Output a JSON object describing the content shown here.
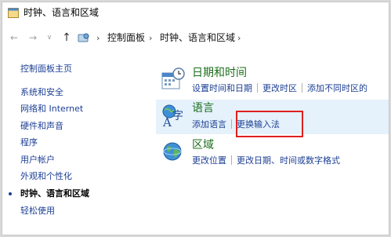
{
  "window": {
    "title": "时钟、语言和区域"
  },
  "address_bar": {
    "crumbs": [
      "控制面板",
      "时钟、语言和区域"
    ]
  },
  "sidebar": {
    "home": "控制面板主页",
    "items": [
      {
        "label": "系统和安全"
      },
      {
        "label": "网络和 Internet"
      },
      {
        "label": "硬件和声音"
      },
      {
        "label": "程序"
      },
      {
        "label": "用户帐户"
      },
      {
        "label": "外观和个性化"
      },
      {
        "label": "时钟、语言和区域",
        "current": true
      },
      {
        "label": "轻松使用"
      }
    ]
  },
  "categories": [
    {
      "title": "日期和时间",
      "icon": "clock-calendar-icon",
      "links": [
        "设置时间和日期",
        "更改时区",
        "添加不同时区的"
      ]
    },
    {
      "title": "语言",
      "icon": "language-icon",
      "links": [
        "添加语言",
        "更换输入法"
      ]
    },
    {
      "title": "区域",
      "icon": "globe-icon",
      "links": [
        "更改位置",
        "更改日期、时间或数字格式"
      ]
    }
  ],
  "annotation": {
    "color": "#e0201f"
  }
}
